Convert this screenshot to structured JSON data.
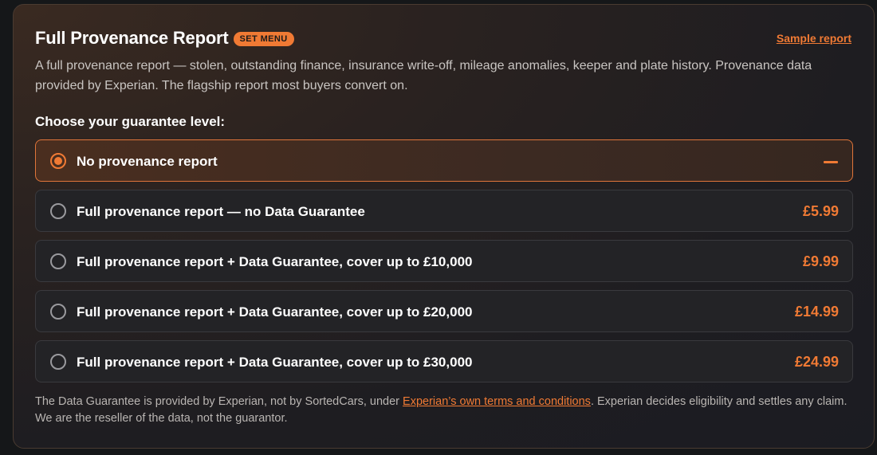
{
  "header": {
    "title": "Full Provenance Report",
    "badge": "SET MENU",
    "sample_link": "Sample report"
  },
  "description": "A full provenance report — stolen, outstanding finance, insurance write-off, mileage anomalies, keeper and plate history. Provenance data provided by Experian. The flagship report most buyers convert on.",
  "choose_label": "Choose your guarantee level:",
  "options": [
    {
      "label": "No provenance report",
      "price": "",
      "selected": true
    },
    {
      "label": "Full provenance report — no Data Guarantee",
      "price": "£5.99",
      "selected": false
    },
    {
      "label": "Full provenance report + Data Guarantee, cover up to £10,000",
      "price": "£9.99",
      "selected": false
    },
    {
      "label": "Full provenance report + Data Guarantee, cover up to £20,000",
      "price": "£14.99",
      "selected": false
    },
    {
      "label": "Full provenance report + Data Guarantee, cover up to £30,000",
      "price": "£24.99",
      "selected": false
    }
  ],
  "footer": {
    "text_before": "The Data Guarantee is provided by Experian, not by SortedCars, under ",
    "link": "Experian’s own terms and conditions",
    "text_after": ". Experian decides eligibility and settles any claim. We are the reseller of the data, not the guarantor."
  },
  "colors": {
    "accent": "#f07a34",
    "background": "#151719",
    "card_border": "#4a3b31"
  },
  "icons": {
    "no_price_indicator": "dash-icon"
  }
}
